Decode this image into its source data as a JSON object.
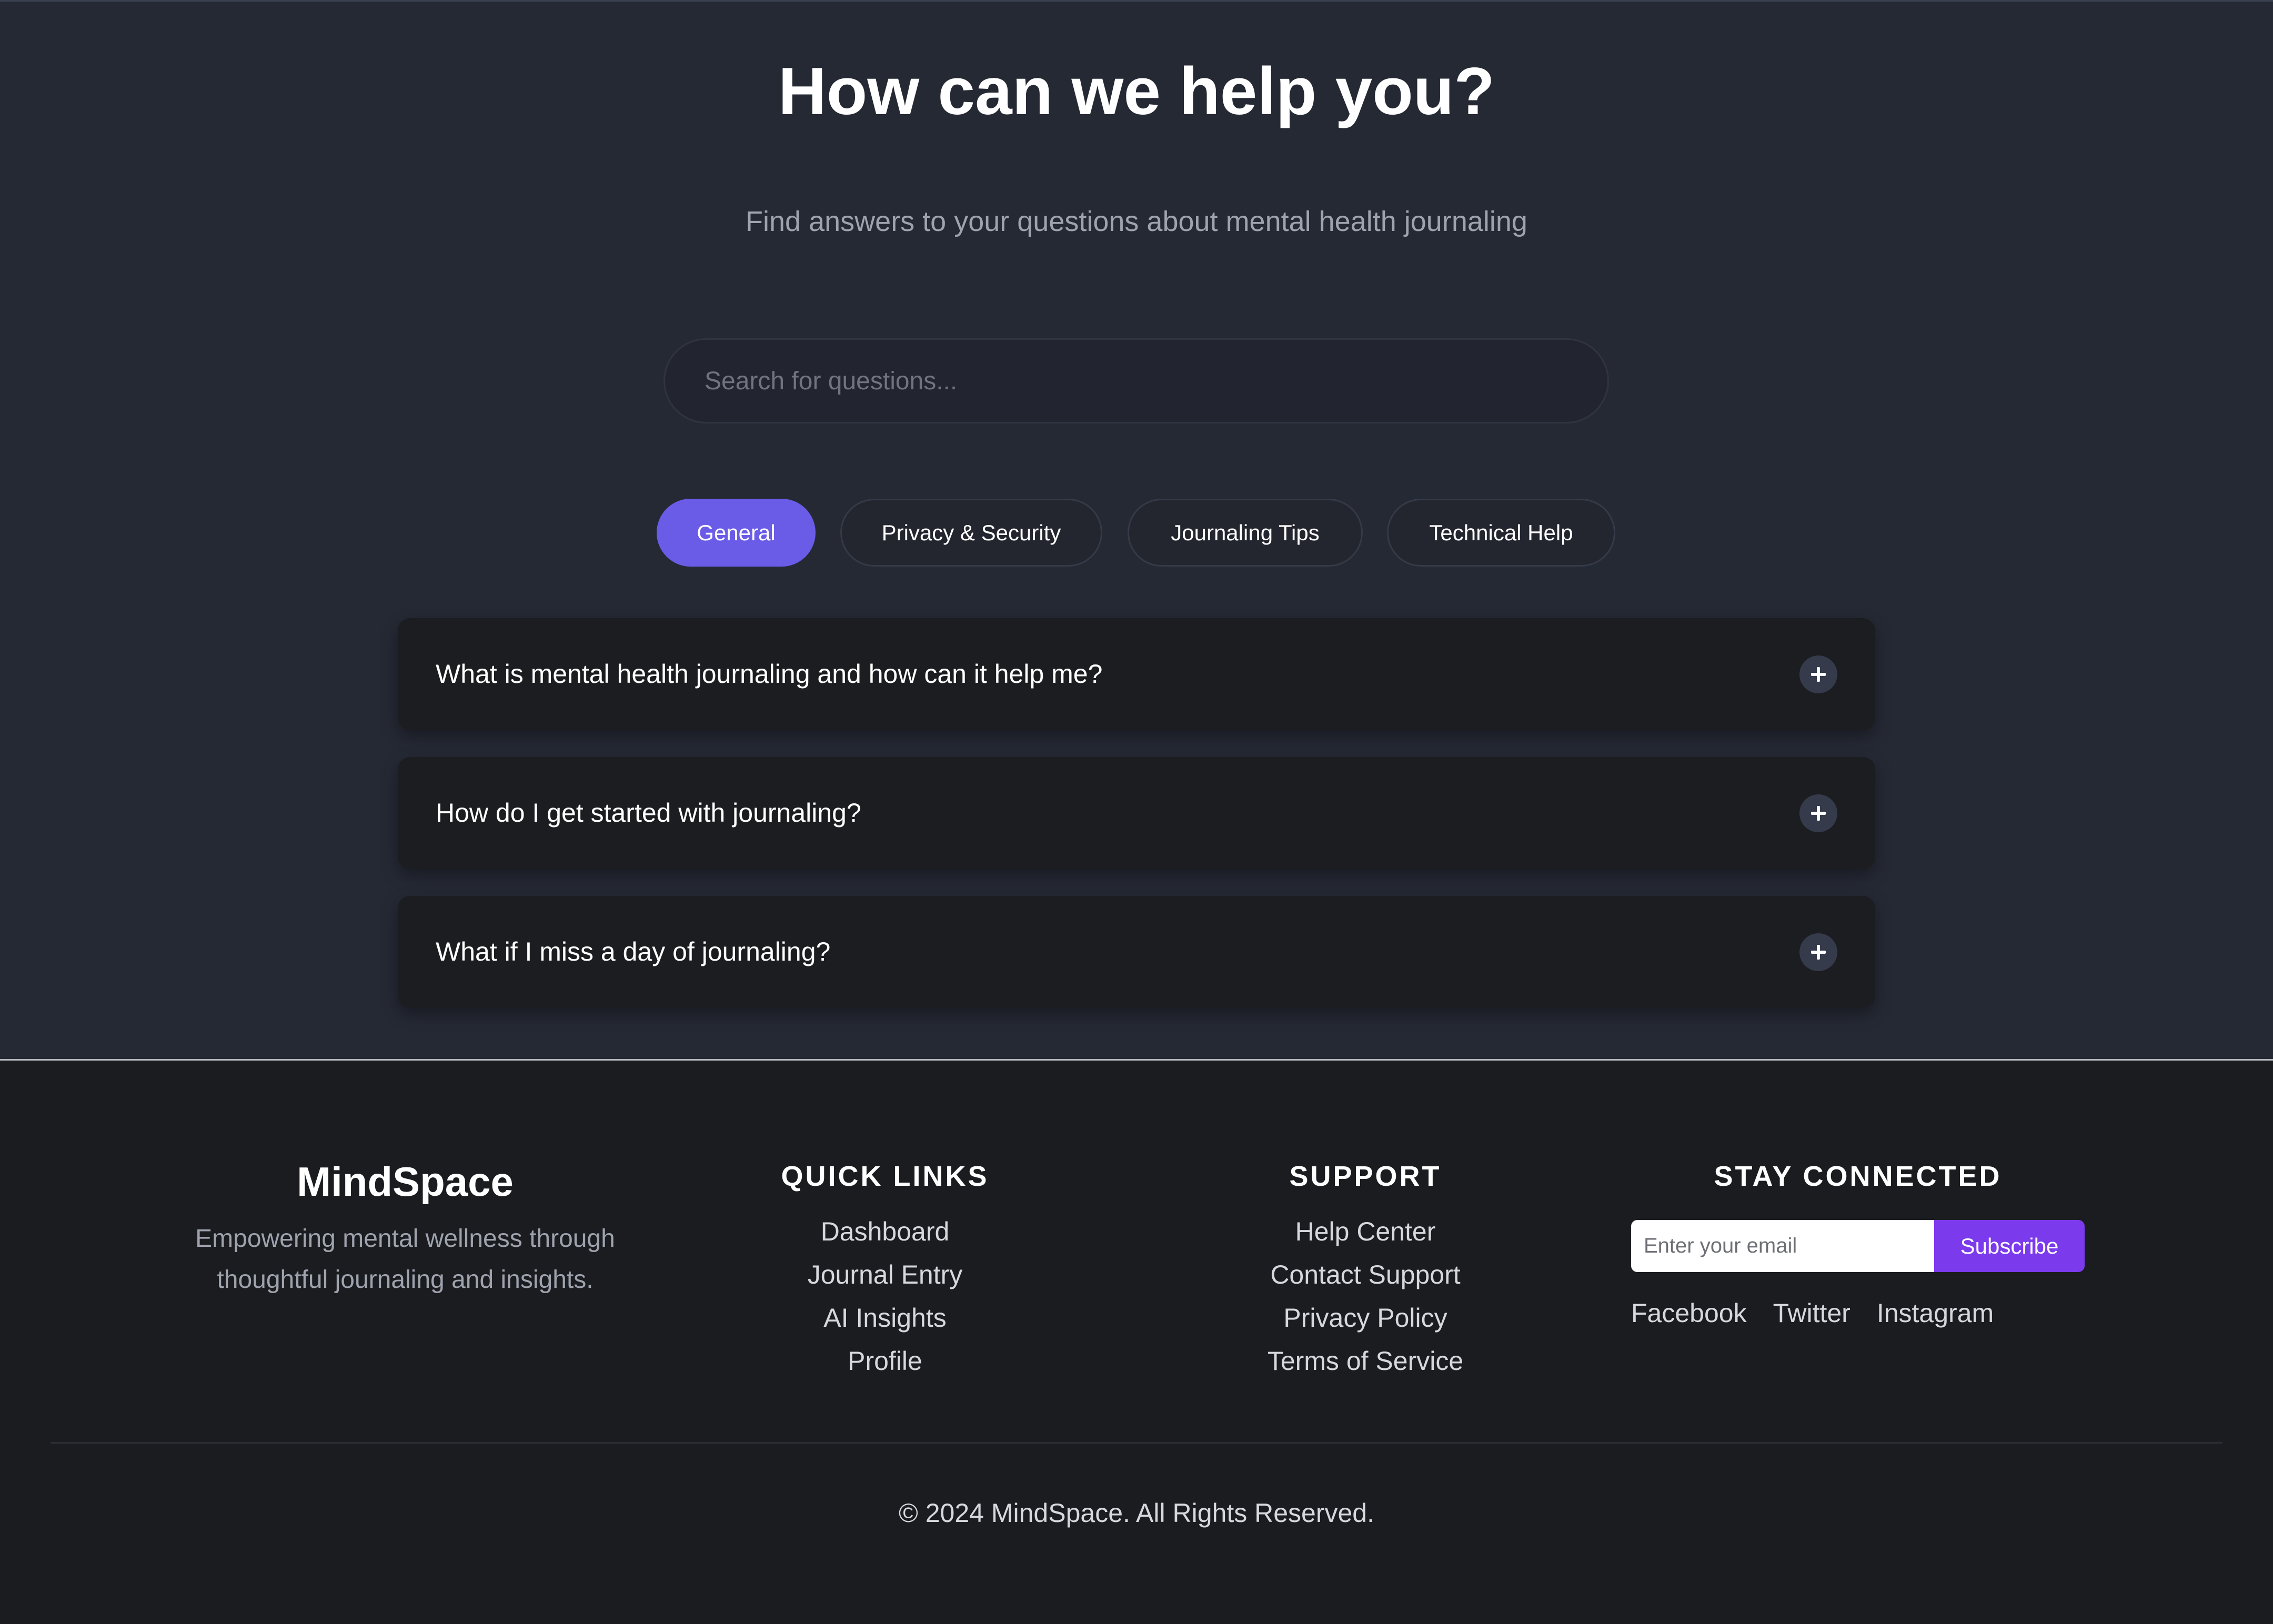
{
  "faq": {
    "title": "How can we help you?",
    "subtitle": "Find answers to your questions about mental health journaling",
    "search_placeholder": "Search for questions...",
    "tabs": [
      {
        "label": "General",
        "active": true
      },
      {
        "label": "Privacy & Security",
        "active": false
      },
      {
        "label": "Journaling Tips",
        "active": false
      },
      {
        "label": "Technical Help",
        "active": false
      }
    ],
    "items": [
      {
        "question": "What is mental health journaling and how can it help me?",
        "toggle_icon": "plus-icon"
      },
      {
        "question": "How do I get started with journaling?",
        "toggle_icon": "plus-icon"
      },
      {
        "question": "What if I miss a day of journaling?",
        "toggle_icon": "plus-icon"
      }
    ]
  },
  "footer": {
    "brand": {
      "name": "MindSpace",
      "description": "Empowering mental wellness through thoughtful journaling and insights."
    },
    "quick_links": {
      "heading": "QUICK LINKS",
      "links": [
        "Dashboard",
        "Journal Entry",
        "AI Insights",
        "Profile"
      ]
    },
    "support": {
      "heading": "SUPPORT",
      "links": [
        "Help Center",
        "Contact Support",
        "Privacy Policy",
        "Terms of Service"
      ]
    },
    "stay_connected": {
      "heading": "STAY CONNECTED",
      "email_placeholder": "Enter your email",
      "subscribe_label": "Subscribe",
      "socials": [
        "Facebook",
        "Twitter",
        "Instagram"
      ]
    },
    "copyright": "© 2024 MindSpace. All Rights Reserved."
  },
  "colors": {
    "faq_background": "#252934",
    "footer_background": "#1b1c20",
    "active_tab": "#6b5ce7",
    "subscribe_button": "#7c3aed",
    "faq_card": "#1c1d21"
  }
}
